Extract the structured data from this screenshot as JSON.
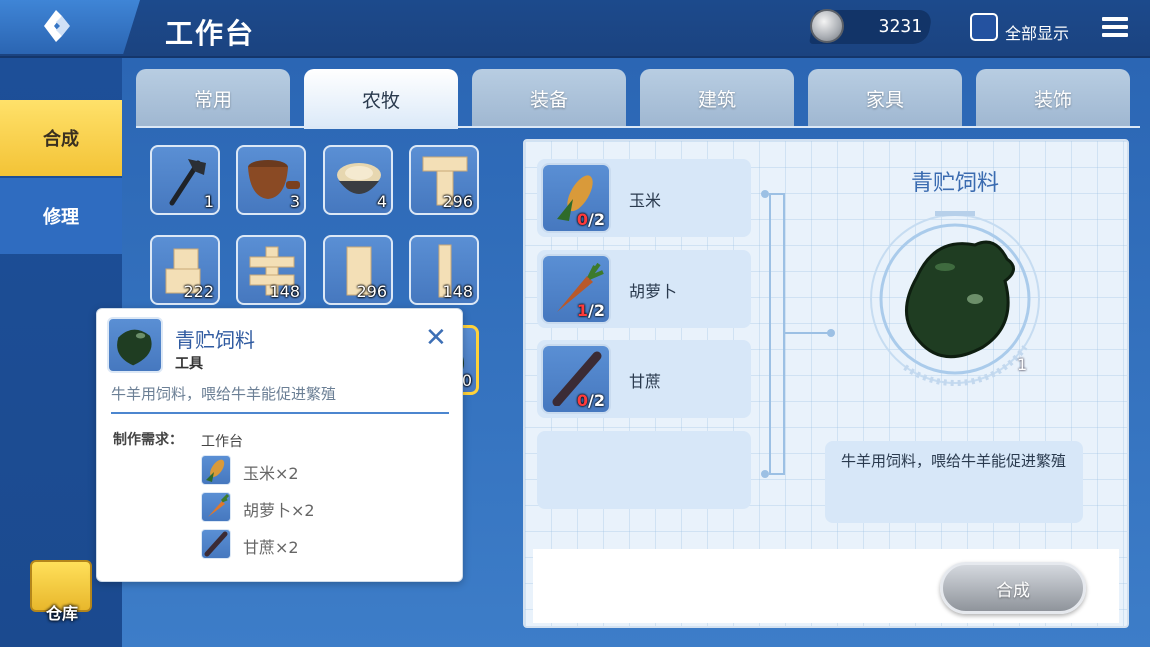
{
  "header": {
    "title": "工作台",
    "coins": "3231",
    "show_all_label": "全部显示",
    "show_all_checked": false
  },
  "sidebar": {
    "tabs": [
      {
        "label": "合成",
        "active": true
      },
      {
        "label": "修理",
        "active": false
      }
    ],
    "warehouse_label": "仓库"
  },
  "tabs": [
    {
      "label": "常用",
      "active": false
    },
    {
      "label": "农牧",
      "active": true
    },
    {
      "label": "装备",
      "active": false
    },
    {
      "label": "建筑",
      "active": false
    },
    {
      "label": "家具",
      "active": false
    },
    {
      "label": "装饰",
      "active": false
    }
  ],
  "grid_items": [
    {
      "icon": "axe-icon",
      "count": "1"
    },
    {
      "icon": "pot-icon",
      "count": "3"
    },
    {
      "icon": "bowl-icon",
      "count": "4"
    },
    {
      "icon": "table-block-icon",
      "count": "296"
    },
    {
      "icon": "block-icon",
      "count": "222"
    },
    {
      "icon": "fence-block-icon",
      "count": "148"
    },
    {
      "icon": "pillar-block-icon",
      "count": "296"
    },
    {
      "icon": "post-block-icon",
      "count": "148"
    },
    {
      "icon": "feed-icon",
      "count": "0",
      "selected": true
    }
  ],
  "tooltip": {
    "title": "青贮饲料",
    "type": "工具",
    "close_glyph": "✕",
    "description": "牛羊用饲料，喂给牛羊能促进繁殖",
    "requirements_label": "制作需求：",
    "station": "工作台",
    "materials": [
      {
        "icon": "corn-icon",
        "text": "玉米×2"
      },
      {
        "icon": "carrot-icon",
        "text": "胡萝卜×2"
      },
      {
        "icon": "sugarcane-icon",
        "text": "甘蔗×2"
      }
    ]
  },
  "recipe": {
    "ingredients": [
      {
        "name": "玉米",
        "have": "0",
        "need": "/2",
        "icon": "corn-icon"
      },
      {
        "name": "胡萝卜",
        "have": "1",
        "need": "/2",
        "icon": "carrot-icon"
      },
      {
        "name": "甘蔗",
        "have": "0",
        "need": "/2",
        "icon": "sugarcane-icon"
      }
    ],
    "product": {
      "name": "青贮饲料",
      "count": "1",
      "description": "牛羊用饲料，喂给牛羊能促进繁殖"
    },
    "craft_button": "合成"
  },
  "colors": {
    "accent_yellow": "#f3c336",
    "product_green": "#1f3d22",
    "missing_red": "#ff3b3b"
  }
}
